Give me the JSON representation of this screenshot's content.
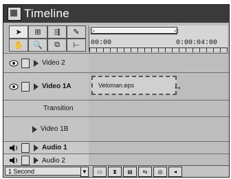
{
  "window": {
    "title": "Timeline"
  },
  "tools": {
    "items": [
      {
        "icon": "arrow-select-icon",
        "glyph": "➤"
      },
      {
        "icon": "range-select-icon",
        "glyph": "⊞"
      },
      {
        "icon": "track-select-icon",
        "glyph": "⇶"
      },
      {
        "icon": "pen-icon",
        "glyph": "✎"
      },
      {
        "icon": "hand-icon",
        "glyph": "✋"
      },
      {
        "icon": "zoom-icon",
        "glyph": "🔍"
      },
      {
        "icon": "razor-icon",
        "glyph": "⧉"
      },
      {
        "icon": "in-out-icon",
        "glyph": "⊢"
      }
    ]
  },
  "ruler": {
    "start_time": "00:00",
    "mark_time": "0:00:04:00",
    "work_area_left": "▷",
    "work_area_right": "◁"
  },
  "tracks": {
    "video2": {
      "name": "Video 2"
    },
    "video1a": {
      "name": "Video 1A"
    },
    "transition": {
      "name": "Transition"
    },
    "video1b": {
      "name": "Video 1B"
    },
    "audio1": {
      "name": "Audio 1"
    },
    "audio2": {
      "name": "Audio 2"
    }
  },
  "clip": {
    "name": "Veloman.eps",
    "resize_cursor": "↔"
  },
  "status": {
    "zoom": "1 Second",
    "dropdown_glyph": "▼",
    "buttons": [
      "▭",
      "⧗",
      "▤",
      "⇆",
      "◎",
      "◂"
    ]
  }
}
